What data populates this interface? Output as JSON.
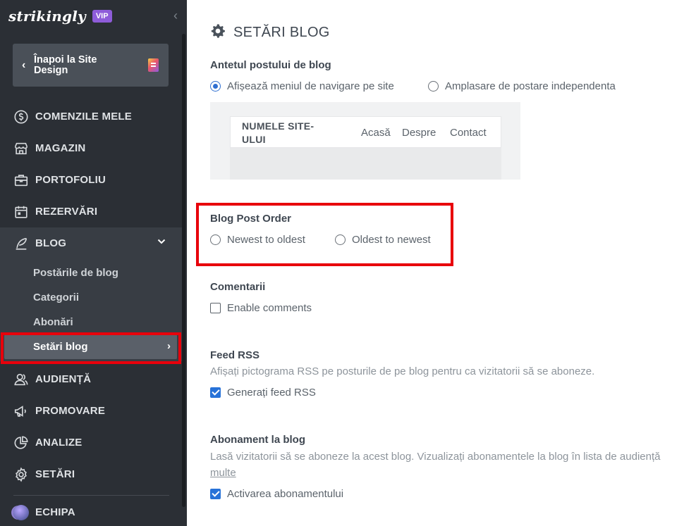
{
  "sidebar": {
    "logo": "strikingly",
    "badge": "VIP",
    "collapse_icon": "chevron-left-icon",
    "back_label": "Înapoi la Site Design",
    "items": [
      {
        "label": "COMENZILE MELE",
        "icon": "dollar-circle-icon"
      },
      {
        "label": "MAGAZIN",
        "icon": "store-icon"
      },
      {
        "label": "PORTOFOLIU",
        "icon": "briefcase-icon"
      },
      {
        "label": "REZERVĂRI",
        "icon": "calendar-icon"
      },
      {
        "label": "BLOG",
        "icon": "quill-icon"
      },
      {
        "label": "AUDIENȚĂ",
        "icon": "users-icon"
      },
      {
        "label": "PROMOVARE",
        "icon": "megaphone-icon"
      },
      {
        "label": "ANALIZE",
        "icon": "pie-chart-icon"
      },
      {
        "label": "SETĂRI",
        "icon": "gear-icon"
      },
      {
        "label": "ECHIPA",
        "icon": "avatar"
      }
    ],
    "blog_sub": [
      "Postările de blog",
      "Categorii",
      "Abonări",
      "Setări blog"
    ]
  },
  "main": {
    "title": "SETĂRI BLOG",
    "header_section": {
      "label": "Antetul postului de blog",
      "options": [
        "Afișează meniul de navigare pe site",
        "Amplasare de postare independenta"
      ],
      "selected": 0
    },
    "preview": {
      "site_name": "NUMELE SITE-ULUI",
      "links": [
        "Acasă",
        "Despre",
        "Contact"
      ]
    },
    "order_section": {
      "label": "Blog Post Order",
      "options": [
        "Newest to oldest",
        "Oldest to newest"
      ]
    },
    "comments_section": {
      "label": "Comentarii",
      "checkbox": "Enable comments",
      "checked": false
    },
    "rss_section": {
      "label": "Feed RSS",
      "desc": "Afișați pictograma RSS pe posturile de pe blog pentru ca vizitatorii să se aboneze.",
      "checkbox": "Generați feed RSS",
      "checked": true
    },
    "subscribe_section": {
      "label": "Abonament la blog",
      "desc": "Lasă vizitatorii să se aboneze la acest blog. Vizualizați abonamentele la blog în lista de audiență",
      "link": "multe",
      "checkbox": "Activarea abonamentului",
      "checked": true
    },
    "highlight_color": "#e8000b",
    "accent_color": "#2772d8"
  }
}
